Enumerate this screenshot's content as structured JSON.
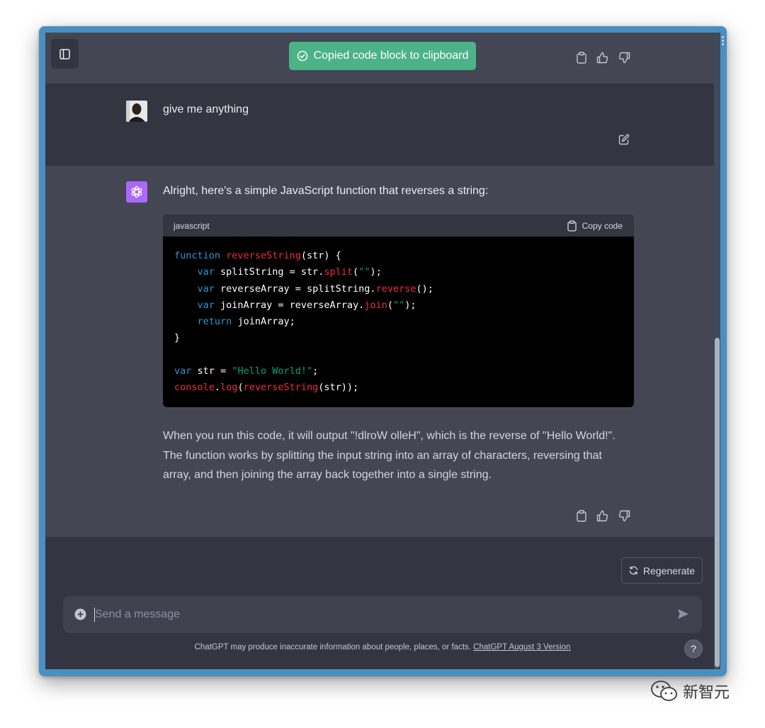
{
  "toast": {
    "text": "Copied code block to clipboard"
  },
  "user_message": {
    "text": "give me anything"
  },
  "assistant_message": {
    "intro": "Alright, here's a simple JavaScript function that reverses a string:",
    "code_block": {
      "language": "javascript",
      "copy_label": "Copy code",
      "lines": [
        "function reverseString(str) {",
        "    var splitString = str.split(\"\");",
        "    var reverseArray = splitString.reverse();",
        "    var joinArray = reverseArray.join(\"\");",
        "    return joinArray;",
        "}",
        "",
        "var str = \"Hello World!\";",
        "console.log(reverseString(str));"
      ]
    },
    "paragraph": "When you run this code, it will output \"!dlroW olleH\", which is the reverse of \"Hello World!\". The function works by splitting the input string into an array of characters, reversing that array, and then joining the array back together into a single string."
  },
  "regenerate": {
    "label": "Regenerate"
  },
  "composer": {
    "placeholder": "Send a message"
  },
  "footer": {
    "note": "ChatGPT may produce inaccurate information about people, places, or facts. ",
    "version_link": "ChatGPT August 3 Version"
  },
  "help": {
    "label": "?"
  },
  "watermark": {
    "text": "新智元"
  },
  "colors": {
    "app_bg": "#343541",
    "assistant_bg": "#444654",
    "toast_bg": "#4cb287",
    "accent_avatar": "#ab68ff",
    "code_keyword": "#2e95d3",
    "code_function": "#f22c3d",
    "code_string": "#00a67d"
  },
  "icons": [
    "sidebar-toggle-icon",
    "check-circle-icon",
    "clipboard-icon",
    "thumbs-up-icon",
    "thumbs-down-icon",
    "edit-icon",
    "openai-logo-icon",
    "refresh-icon",
    "plus-circle-icon",
    "send-icon",
    "wechat-icon"
  ]
}
